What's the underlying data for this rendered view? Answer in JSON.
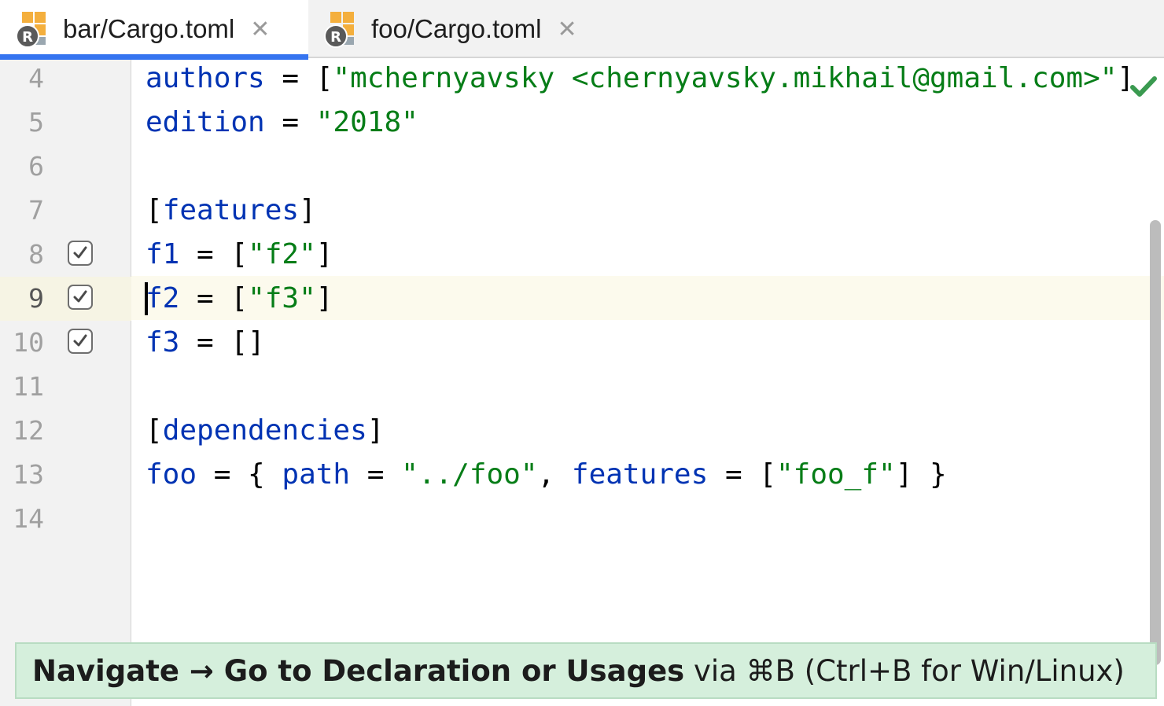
{
  "tabs": [
    {
      "label": "bar/Cargo.toml",
      "active": true,
      "icon": "rust-toml-file-icon"
    },
    {
      "label": "foo/Cargo.toml",
      "active": false,
      "icon": "rust-toml-file-icon"
    }
  ],
  "tab_close_glyph": "✕",
  "editor": {
    "current_line": 9,
    "line_numbers": [
      "4",
      "5",
      "6",
      "7",
      "8",
      "9",
      "10",
      "11",
      "12",
      "13",
      "14"
    ],
    "lines": {
      "l4": {
        "key": "authors",
        "eq": " = [",
        "str": "\"mchernyavsky <chernyavsky.mikhail@gmail.com>\"",
        "rest": "]"
      },
      "l5": {
        "key": "edition",
        "eq": " = ",
        "str": "\"2018\""
      },
      "l7": {
        "open": "[",
        "key": "features",
        "close": "]"
      },
      "l8": {
        "key": "f1",
        "eq": " = [",
        "str": "\"f2\"",
        "close": "]"
      },
      "l9": {
        "key": "f2",
        "eq": " = [",
        "str": "\"f3\"",
        "close": "]"
      },
      "l10": {
        "key": "f3",
        "eq": " = []"
      },
      "l12": {
        "open": "[",
        "key": "dependencies",
        "close": "]"
      },
      "l13": {
        "key": "foo",
        "p1": " = { ",
        "key2": "path",
        "p2": " = ",
        "str": "\"../foo\"",
        "p3": ", ",
        "key3": "features",
        "p4": " = [",
        "str2": "\"foo_f\"",
        "p5": "] }"
      }
    },
    "feature_checkbox_lines": [
      "8",
      "9",
      "10"
    ],
    "inspection_status": "ok"
  },
  "tip": {
    "bold": "Navigate → Go to Declaration or Usages",
    "plain": " via ⌘B (Ctrl+B for Win/Linux)"
  },
  "colors": {
    "keyword": "#0033b3",
    "string": "#067d17",
    "tab_underline": "#3574f0",
    "current_line": "#fcfaed",
    "tip_background": "#d5efdc",
    "ok_check": "#3a9a50"
  }
}
